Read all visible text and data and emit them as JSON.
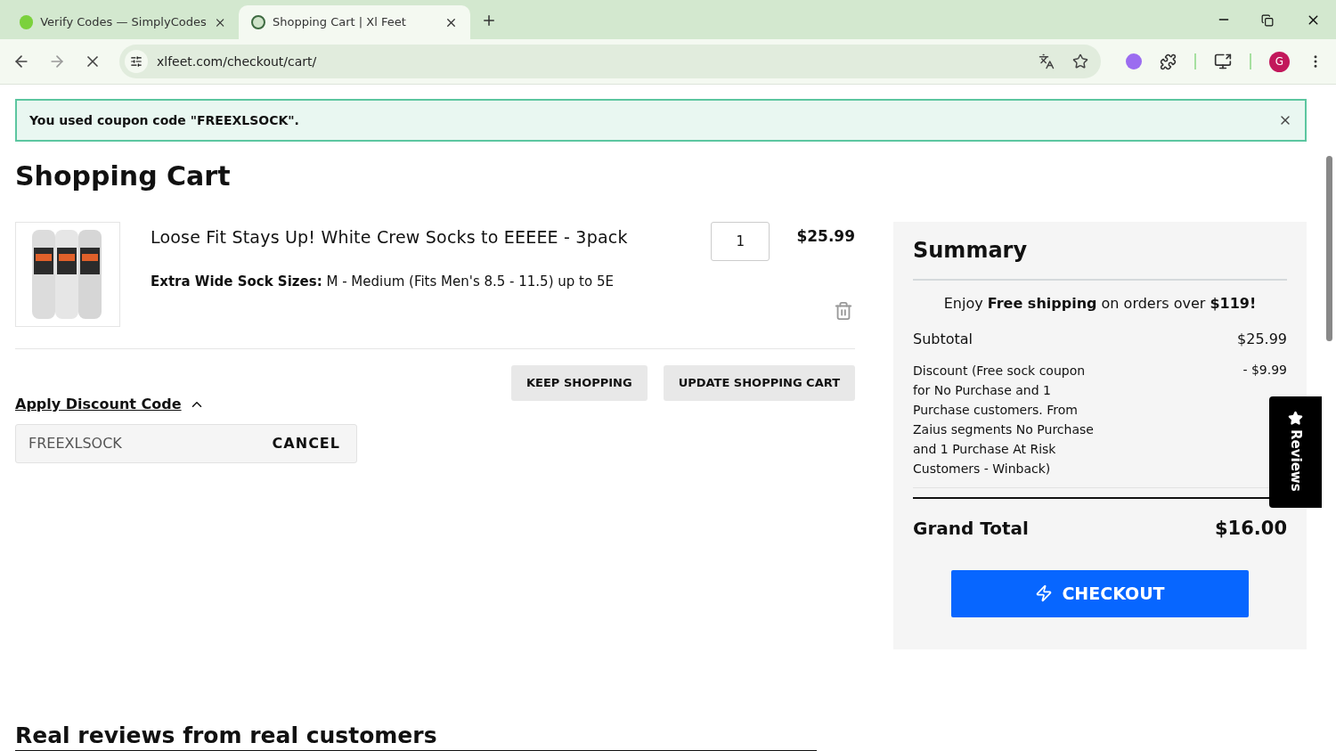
{
  "browser": {
    "tabs": [
      {
        "title": "Verify Codes — SimplyCodes",
        "selected": false
      },
      {
        "title": "Shopping Cart | Xl Feet",
        "selected": true
      }
    ],
    "url": "xlfeet.com/checkout/cart/",
    "profile_initial": "G"
  },
  "alert": {
    "message": "You used coupon code \"FREEXLSOCK\"."
  },
  "page": {
    "title": "Shopping Cart",
    "item": {
      "name": "Loose Fit Stays Up! White Crew Socks to EEEEE - 3pack",
      "option_label": "Extra Wide Sock Sizes:",
      "option_value": "M - Medium (Fits Men's 8.5 - 11.5) up to 5E",
      "quantity": "1",
      "price": "$25.99"
    },
    "buttons": [
      "KEEP SHOPPING",
      "UPDATE SHOPPING CART"
    ],
    "discount": {
      "label": "Apply Discount Code",
      "expanded": true,
      "value": "FREEXLSOCK",
      "action": "CANCEL"
    },
    "reviews_heading": "Real reviews from real customers"
  },
  "summary": {
    "title": "Summary",
    "shipping_note": "Enjoy **Free shipping** on orders over **$119!**",
    "rows": [
      {
        "label": "Subtotal",
        "value": "$25.99"
      },
      {
        "label": "Discount (Free sock coupon for No Purchase and 1 Purchase customers. From Zaius segments No Purchase and 1 Purchase At Risk Customers - Winback)",
        "value": "- $9.99"
      }
    ],
    "grand_total_label": "Grand Total",
    "grand_total": "$16.00",
    "checkout": "CHECKOUT"
  },
  "reviews_tab": {
    "label": "Reviews"
  }
}
